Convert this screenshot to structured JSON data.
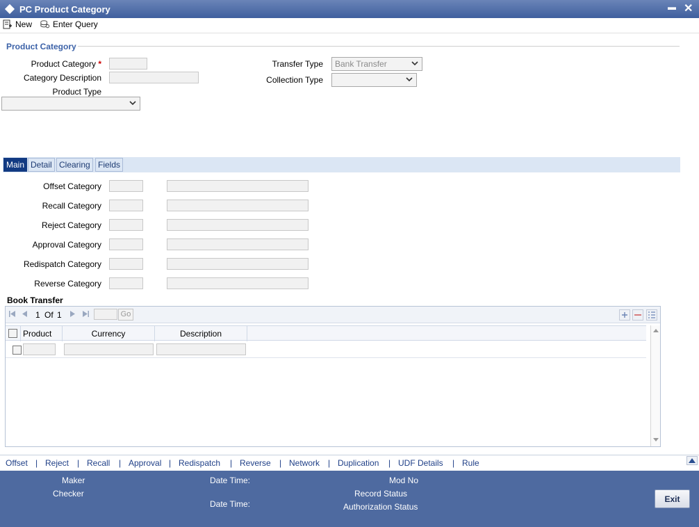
{
  "window": {
    "title": "PC Product Category",
    "minimize_glyph": "▬",
    "close_glyph": "✕"
  },
  "toolbar": {
    "new_label": "New",
    "enter_query_label": "Enter Query"
  },
  "section": {
    "title": "Product Category"
  },
  "form": {
    "product_category_label": "Product Category",
    "required_mark": "*",
    "category_description_label": "Category Description",
    "product_type_label": "Product Type",
    "product_type_value": "",
    "transfer_type_label": "Transfer Type",
    "transfer_type_value": "Bank Transfer",
    "collection_type_label": "Collection Type",
    "collection_type_value": ""
  },
  "tabs": [
    {
      "label": "Main",
      "active": true
    },
    {
      "label": "Detail",
      "active": false
    },
    {
      "label": "Clearing",
      "active": false
    },
    {
      "label": "Fields",
      "active": false
    }
  ],
  "main_tab": {
    "rows": [
      {
        "label": "Offset Category"
      },
      {
        "label": "Recall Category"
      },
      {
        "label": "Reject Category"
      },
      {
        "label": "Approval Category"
      },
      {
        "label": "Redispatch Category"
      },
      {
        "label": "Reverse Category"
      }
    ]
  },
  "book_transfer": {
    "title": "Book Transfer",
    "page_current": "1",
    "page_of_label": "Of",
    "page_total": "1",
    "go_label": "Go",
    "columns": [
      "Product",
      "Currency",
      "Description"
    ]
  },
  "footer_links": [
    "Offset",
    "Reject",
    "Recall",
    "Approval",
    "Redispatch",
    "Reverse",
    "Network",
    "Duplication",
    "UDF Details",
    "Rule"
  ],
  "link_separator": "|",
  "status": {
    "maker_label": "Maker",
    "checker_label": "Checker",
    "datetime_label": "Date Time:",
    "mod_no_label": "Mod No",
    "record_status_label": "Record Status",
    "authorization_status_label": "Authorization Status",
    "exit_label": "Exit"
  },
  "colors": {
    "titlebar": "#3f5f9e",
    "accent": "#3c62a8",
    "active_tab": "#123a82",
    "status_bar": "#4e6aa0",
    "link": "#1f3f87"
  }
}
